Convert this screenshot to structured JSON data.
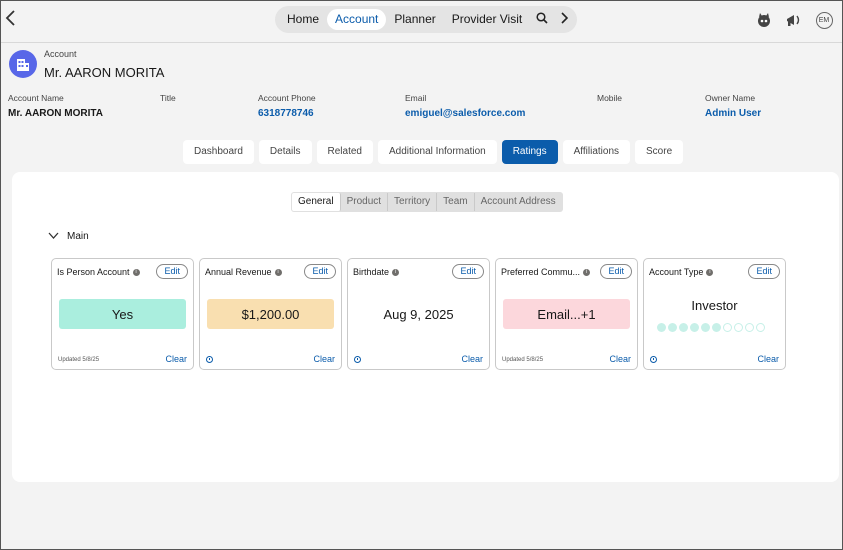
{
  "nav": {
    "items": [
      "Home",
      "Account",
      "Planner",
      "Provider Visit"
    ],
    "active": "Account",
    "user_initials": "EM"
  },
  "header": {
    "kind": "Account",
    "name": "Mr. AARON MORITA"
  },
  "fields": [
    {
      "label": "Account Name",
      "value": "Mr. AARON MORITA"
    },
    {
      "label": "Title",
      "value": ""
    },
    {
      "label": "Account Phone",
      "value": "6318778746"
    },
    {
      "label": "Email",
      "value": "emiguel@salesforce.com"
    },
    {
      "label": "Mobile",
      "value": ""
    },
    {
      "label": "Owner Name",
      "value": "Admin User"
    }
  ],
  "tabs": [
    "Dashboard",
    "Details",
    "Related",
    "Additional Information",
    "Ratings",
    "Affiliations",
    "Score"
  ],
  "active_tab": "Ratings",
  "subtabs": [
    "General",
    "Product",
    "Territory",
    "Team",
    "Account Address"
  ],
  "active_subtab": "General",
  "section": {
    "label": "Main"
  },
  "cards": [
    {
      "title": "Is Person Account",
      "edit": "Edit",
      "value": "Yes",
      "footer": "Updated 5/8/25",
      "clear": "Clear",
      "color": "#aaeede"
    },
    {
      "title": "Annual Revenue",
      "edit": "Edit",
      "value": "$1,200.00",
      "footer": "",
      "clear": "Clear",
      "color": "#f9dfb0"
    },
    {
      "title": "Birthdate",
      "edit": "Edit",
      "value": "Aug 9, 2025",
      "footer": "",
      "clear": "Clear",
      "color": ""
    },
    {
      "title": "Preferred Commu...",
      "edit": "Edit",
      "value": "Email...+1",
      "footer": "Updated 5/8/25",
      "clear": "Clear",
      "color": "#fcd7dc"
    },
    {
      "title": "Account Type",
      "edit": "Edit",
      "value": "Investor",
      "footer": "",
      "clear": "Clear",
      "color": "",
      "rating": {
        "filled": 6,
        "total": 10
      }
    }
  ],
  "colors": {
    "brand": "#0b5cab",
    "account_icon": "#5867e8"
  }
}
